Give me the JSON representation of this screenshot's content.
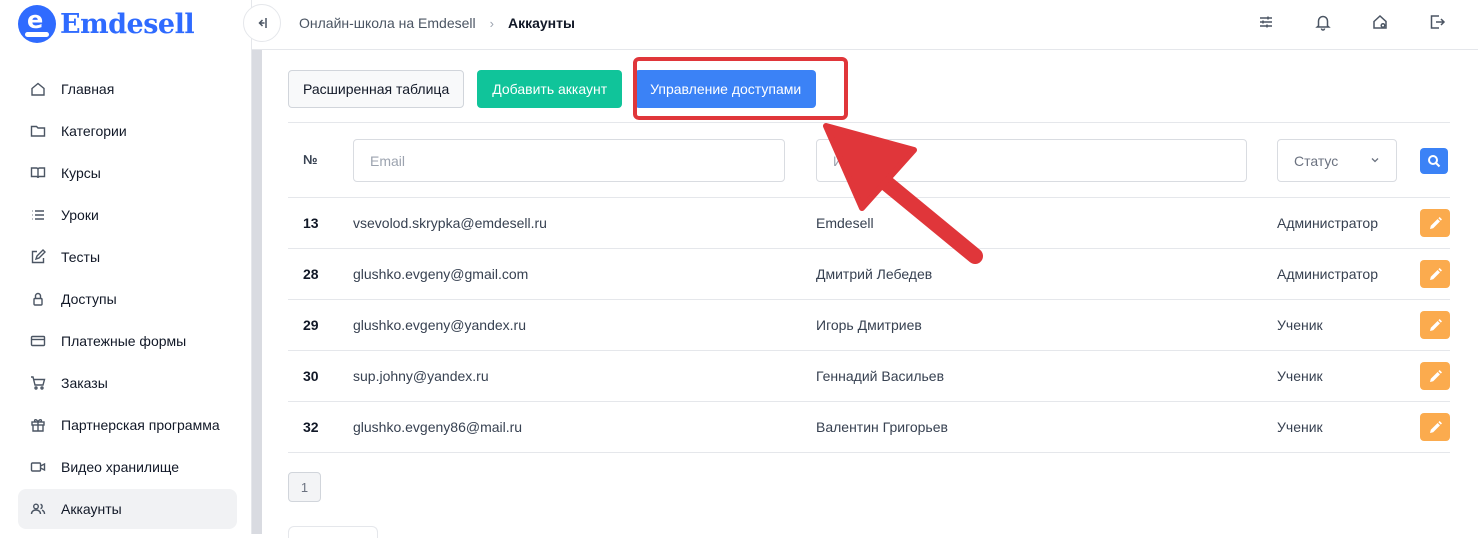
{
  "app": {
    "logo_text": "Emdesell",
    "logo_letter": "e"
  },
  "sidebar": {
    "items": [
      {
        "label": "Главная",
        "icon": "home-icon"
      },
      {
        "label": "Категории",
        "icon": "folder-icon"
      },
      {
        "label": "Курсы",
        "icon": "book-icon"
      },
      {
        "label": "Уроки",
        "icon": "list-icon"
      },
      {
        "label": "Тесты",
        "icon": "edit-icon"
      },
      {
        "label": "Доступы",
        "icon": "lock-icon"
      },
      {
        "label": "Платежные формы",
        "icon": "credit-card-icon"
      },
      {
        "label": "Заказы",
        "icon": "cart-icon"
      },
      {
        "label": "Партнерская программа",
        "icon": "gift-icon"
      },
      {
        "label": "Видео хранилище",
        "icon": "video-icon"
      },
      {
        "label": "Аккаунты",
        "icon": "users-icon",
        "active": true
      }
    ]
  },
  "header": {
    "breadcrumb": [
      "Онлайн-школа на Emdesell",
      "Аккаунты"
    ],
    "icons": [
      "sliders-icon",
      "bell-icon",
      "home-settings-icon",
      "logout-icon"
    ]
  },
  "toolbar": {
    "extended_table": "Расширенная таблица",
    "add_account": "Добавить аккаунт",
    "access_management": "Управление доступами"
  },
  "filters": {
    "num_label": "№",
    "email_placeholder": "Email",
    "name_placeholder": "Имя",
    "status_placeholder": "Статус"
  },
  "rows": [
    {
      "num": "13",
      "email": "vsevolod.skrypka@emdesell.ru",
      "name": "Emdesell",
      "role": "Администратор"
    },
    {
      "num": "28",
      "email": "glushko.evgeny@gmail.com",
      "name": "Дмитрий Лебедев",
      "role": "Администратор"
    },
    {
      "num": "29",
      "email": "glushko.evgeny@yandex.ru",
      "name": "Игорь Дмитриев",
      "role": "Ученик"
    },
    {
      "num": "30",
      "email": "sup.johny@yandex.ru",
      "name": "Геннадий Васильев",
      "role": "Ученик"
    },
    {
      "num": "32",
      "email": "glushko.evgeny86@mail.ru",
      "name": "Валентин Григорьев",
      "role": "Ученик"
    }
  ],
  "pagination": {
    "current": "1"
  },
  "colors": {
    "accent": "#3b82f6",
    "success": "#10c49a",
    "edit": "#fbab4e",
    "annotation": "#e0363a"
  }
}
